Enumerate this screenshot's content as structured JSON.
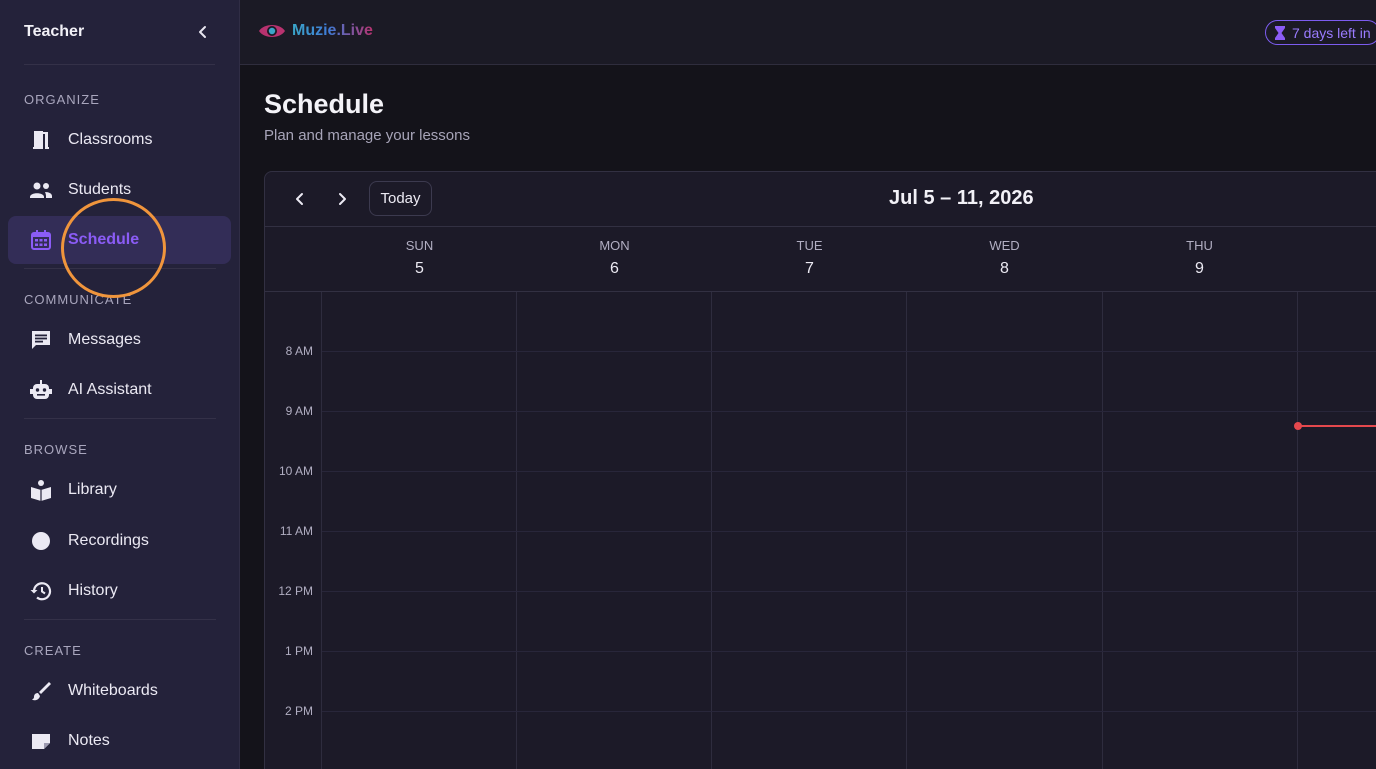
{
  "sidebar": {
    "title": "Teacher",
    "sections": [
      {
        "label": "ORGANIZE"
      },
      {
        "label": "COMMUNICATE"
      },
      {
        "label": "BROWSE"
      },
      {
        "label": "CREATE"
      }
    ],
    "items": [
      {
        "label": "Classrooms",
        "icon": "door-icon"
      },
      {
        "label": "Students",
        "icon": "people-icon"
      },
      {
        "label": "Schedule",
        "icon": "calendar-icon",
        "active": true
      },
      {
        "label": "Messages",
        "icon": "message-icon"
      },
      {
        "label": "AI Assistant",
        "icon": "robot-icon"
      },
      {
        "label": "Library",
        "icon": "book-icon"
      },
      {
        "label": "Recordings",
        "icon": "record-icon"
      },
      {
        "label": "History",
        "icon": "history-icon"
      },
      {
        "label": "Whiteboards",
        "icon": "brush-icon"
      },
      {
        "label": "Notes",
        "icon": "note-icon"
      }
    ]
  },
  "topbar": {
    "logo": "Muzie.Live",
    "trial": "7 days left in"
  },
  "page": {
    "title": "Schedule",
    "subtitle": "Plan and manage your lessons"
  },
  "calendar": {
    "today_label": "Today",
    "range": "Jul 5 – 11, 2026",
    "days": [
      {
        "name": "SUN",
        "num": "5"
      },
      {
        "name": "MON",
        "num": "6"
      },
      {
        "name": "TUE",
        "num": "7"
      },
      {
        "name": "WED",
        "num": "8"
      },
      {
        "name": "THU",
        "num": "9"
      }
    ],
    "times": [
      "8 AM",
      "9 AM",
      "10 AM",
      "11 AM",
      "12 PM",
      "1 PM",
      "2 PM"
    ]
  },
  "colors": {
    "accent": "#8b5cf6",
    "highlight": "#f0953c",
    "now_indicator": "#e5484d"
  }
}
